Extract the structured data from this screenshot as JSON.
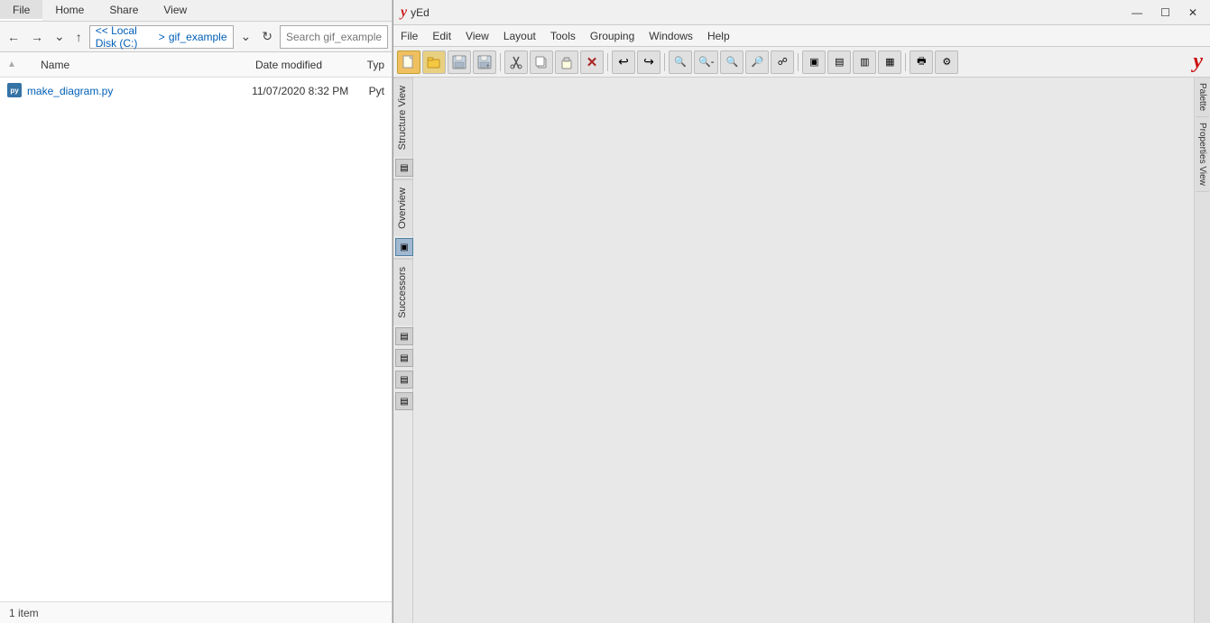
{
  "explorer": {
    "tabs": [
      "File",
      "Home",
      "Share",
      "View"
    ],
    "active_tab": "File",
    "address": {
      "prefix": "<< Local Disk (C:)",
      "separator": ">",
      "folder": "gif_example"
    },
    "columns": {
      "name": "Name",
      "date_modified": "Date modified",
      "type": "Typ"
    },
    "files": [
      {
        "name": "make_diagram.py",
        "date_modified": "11/07/2020 8:32 PM",
        "type": "Pyt",
        "icon": "py"
      }
    ],
    "status": "1 item",
    "search_placeholder": "Search gif_example"
  },
  "yed": {
    "title": "yEd",
    "title_icon": "y",
    "window_controls": {
      "minimize": "—",
      "maximize": "☐",
      "close": "✕"
    },
    "menu": [
      "File",
      "Edit",
      "View",
      "Layout",
      "Tools",
      "Grouping",
      "Windows",
      "Help"
    ],
    "toolbar_buttons": [
      {
        "icon": "📄",
        "name": "new"
      },
      {
        "icon": "📂",
        "name": "open"
      },
      {
        "icon": "💾",
        "name": "save"
      },
      {
        "icon": "💾",
        "name": "save-as"
      },
      {
        "icon": "✂",
        "name": "cut"
      },
      {
        "icon": "📋",
        "name": "copy"
      },
      {
        "icon": "📋",
        "name": "paste"
      },
      {
        "icon": "✖",
        "name": "delete"
      },
      {
        "icon": "↩",
        "name": "undo"
      },
      {
        "icon": "↪",
        "name": "redo"
      },
      {
        "icon": "🔍",
        "name": "zoom-fit"
      },
      {
        "icon": "🔍",
        "name": "zoom-in-sel"
      },
      {
        "icon": "🔍",
        "name": "zoom-out"
      },
      {
        "icon": "🔍",
        "name": "zoom-in"
      },
      {
        "icon": "🔍",
        "name": "zoom-100"
      },
      {
        "icon": "⬛",
        "name": "fit-page"
      },
      {
        "icon": "⬛",
        "name": "grid"
      },
      {
        "icon": "⬛",
        "name": "snap"
      },
      {
        "icon": "⬛",
        "name": "overview"
      },
      {
        "icon": "⬛",
        "name": "print"
      },
      {
        "icon": "⬛",
        "name": "settings"
      }
    ],
    "left_panels": [
      "Structure View",
      "Overview",
      "Successors"
    ],
    "side_panels": [
      "Palette",
      "Properties View"
    ],
    "overview_icon": "⊞",
    "panel_icons": [
      "⊟",
      "⊟",
      "⊟",
      "⊟",
      "⊟"
    ]
  }
}
